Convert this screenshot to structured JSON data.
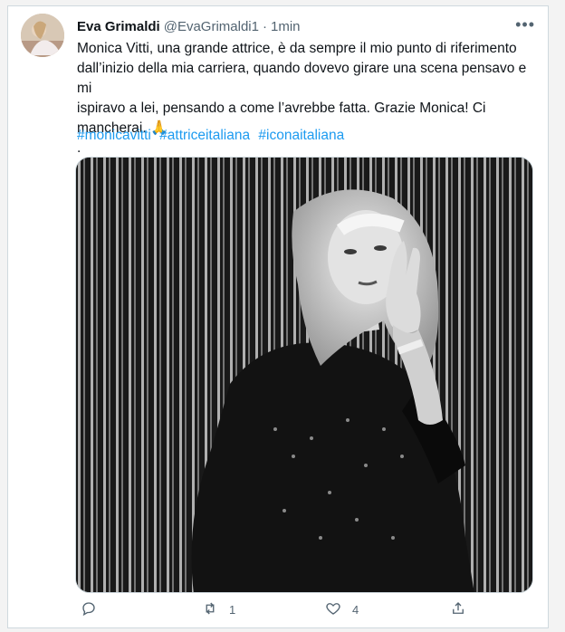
{
  "tweet": {
    "author_name": "Eva Grimaldi",
    "handle": "@EvaGrimaldi1",
    "separator": "·",
    "time": "1min",
    "more": "•••",
    "text": "Monica Vitti, una grande attrice, è da sempre il mio punto di riferimento\ndall’inizio della mia carriera, quando dovevo girare una scena pensavo e mi\nispiravo a lei, pensando a come l’avrebbe fatta. Grazie Monica! Ci\nmancherai. 🙏\n.",
    "hashtags": [
      "#monicavitti",
      "#attriceitaliana",
      "#iconaitaliana"
    ]
  },
  "actions": {
    "reply_icon": "reply-icon",
    "retweet_icon": "retweet-icon",
    "retweet_count": "1",
    "like_icon": "heart-icon",
    "like_count": "4",
    "share_icon": "share-icon"
  },
  "colors": {
    "link": "#1d9bf0",
    "secondary_text": "#536471",
    "border": "#cfd9de"
  }
}
